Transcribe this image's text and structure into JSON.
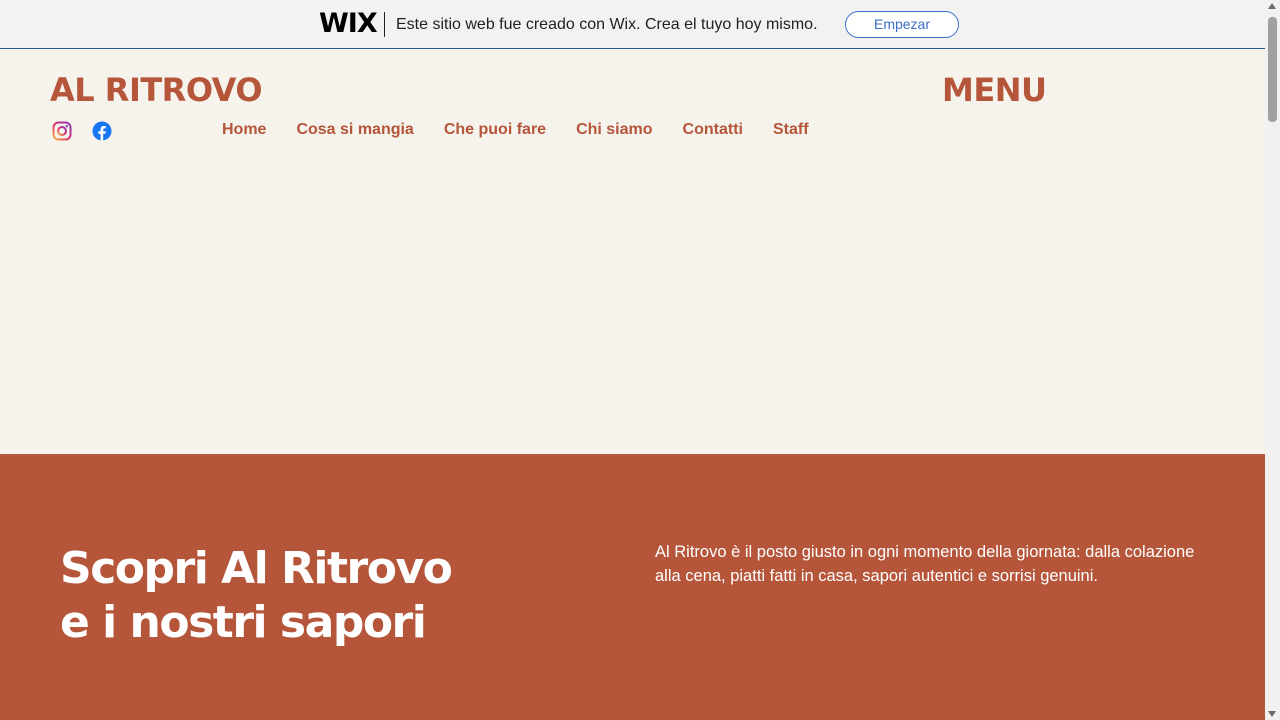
{
  "wix_banner": {
    "logo": "WIX",
    "message": "Este sitio web fue creado con Wix. Crea el tuyo hoy mismo.",
    "button_label": "Empezar"
  },
  "header": {
    "site_title": "AL RITROVO",
    "menu_title": "MENU",
    "social": [
      "instagram-icon",
      "facebook-icon"
    ],
    "nav": [
      "Home",
      "Cosa si mangia",
      "Che puoi fare",
      "Chi siamo",
      "Contatti",
      "Staff"
    ]
  },
  "hero": {
    "title_line1": "Scopri Al Ritrovo",
    "title_line2": "e i nostri sapori",
    "description": "Al Ritrovo è il posto giusto in ogni momento della giornata: dalla colazione alla cena, piatti fatti in casa, sapori autentici e sorrisi genuini."
  },
  "colors": {
    "brand": "#b5553a",
    "page_bg": "#f6f2ec",
    "wix_accent": "#3b6ec9"
  }
}
